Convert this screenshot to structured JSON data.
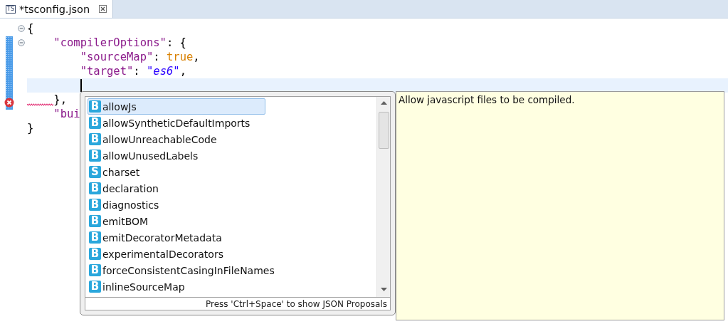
{
  "tab": {
    "icon_text": "TS",
    "title": "*tsconfig.json",
    "selected": true
  },
  "editor": {
    "lines": [
      {
        "foldable": true,
        "current": false,
        "error": false,
        "cursor": false,
        "tokens": [
          {
            "kind": "punct",
            "text": "{"
          }
        ],
        "children": [
          {
            "foldable": true,
            "current": false,
            "error": false,
            "cursor": false,
            "tokens": [
              {
                "kind": "key",
                "text": "\"compilerOptions\""
              },
              {
                "kind": "punct",
                "text": ": {"
              }
            ],
            "children": [
              {
                "foldable": false,
                "current": false,
                "error": false,
                "cursor": false,
                "tokens": [
                  {
                    "kind": "key",
                    "text": "\"sourceMap\""
                  },
                  {
                    "kind": "punct",
                    "text": ": "
                  },
                  {
                    "kind": "bool",
                    "text": "true"
                  },
                  {
                    "kind": "punct",
                    "text": ","
                  }
                ]
              },
              {
                "foldable": false,
                "current": false,
                "error": false,
                "cursor": false,
                "tokens": [
                  {
                    "kind": "key",
                    "text": "\"target\""
                  },
                  {
                    "kind": "punct",
                    "text": ": "
                  },
                  {
                    "kind": "string",
                    "text": "\"es6\""
                  },
                  {
                    "kind": "punct",
                    "text": ","
                  }
                ]
              },
              {
                "foldable": false,
                "current": true,
                "error": false,
                "cursor": true
              }
            ]
          },
          {
            "foldable": false,
            "current": false,
            "error": true,
            "cursor": false,
            "tokens": [
              {
                "kind": "punct",
                "text": "},"
              }
            ]
          },
          {
            "foldable": false,
            "current": false,
            "error": false,
            "cursor": false,
            "tokens": [
              {
                "kind": "key",
                "text": "\"bui"
              }
            ]
          }
        ]
      },
      {
        "foldable": false,
        "current": false,
        "error": false,
        "cursor": false,
        "tokens": [
          {
            "kind": "punct",
            "text": "}"
          }
        ]
      }
    ]
  },
  "proposals": {
    "items": [
      {
        "icon_text": "B",
        "label": "allowJs",
        "selected": true
      },
      {
        "icon_text": "B",
        "label": "allowSyntheticDefaultImports",
        "selected": false
      },
      {
        "icon_text": "B",
        "label": "allowUnreachableCode",
        "selected": false
      },
      {
        "icon_text": "B",
        "label": "allowUnusedLabels",
        "selected": false
      },
      {
        "icon_text": "S",
        "label": "charset",
        "selected": false
      },
      {
        "icon_text": "B",
        "label": "declaration",
        "selected": false
      },
      {
        "icon_text": "B",
        "label": "diagnostics",
        "selected": false
      },
      {
        "icon_text": "B",
        "label": "emitBOM",
        "selected": false
      },
      {
        "icon_text": "B",
        "label": "emitDecoratorMetadata",
        "selected": false
      },
      {
        "icon_text": "B",
        "label": "experimentalDecorators",
        "selected": false
      },
      {
        "icon_text": "B",
        "label": "forceConsistentCasingInFileNames",
        "selected": false
      },
      {
        "icon_text": "B",
        "label": "inlineSourceMap",
        "selected": false
      }
    ],
    "footer": "Press 'Ctrl+Space' to show JSON Proposals"
  },
  "documentation": {
    "text": "Allow javascript files to be compiled."
  }
}
